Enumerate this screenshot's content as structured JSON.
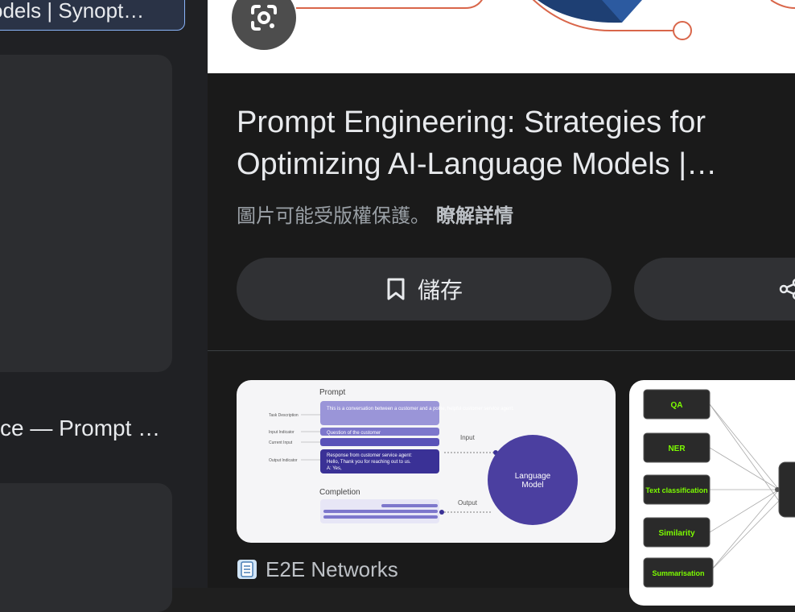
{
  "left": {
    "chip_text": "odels | Synopt…",
    "result2_title": "ce — Prompt …"
  },
  "panel": {
    "title": "Prompt Engineering: Strategies for Optimizing AI-Language Models |…",
    "copyright_notice": "圖片可能受版權保護。",
    "learn_more": "瞭解詳情",
    "save_label": "儲存"
  },
  "related": {
    "thumb1": {
      "prompt_heading": "Prompt",
      "completion_heading": "Completion",
      "task_description": "Task Description",
      "input_indicator": "Input Indicator",
      "current_input": "Current Input",
      "output_indicator": "Output Indicator",
      "box1": "This is a conversation between a customer and a polite, helpful customer service agent.",
      "box2": "Question of the customer",
      "box4a": "Response from customer service agent:",
      "box4b": "Hello, Thank you for reaching out to us.",
      "box4c": "A: Yes,",
      "input_label": "Input",
      "output_label": "Output",
      "model_line1": "Language",
      "model_line2": "Model"
    },
    "thumb2": {
      "items": [
        "QA",
        "NER",
        "Text classification",
        "Similarity",
        "Summarisation"
      ]
    },
    "source_name": "E2E Networks"
  },
  "colors": {
    "accent_blue": "#8ab4f8",
    "model_circle": "#4b3fa0",
    "label_green": "#7CFC00"
  }
}
